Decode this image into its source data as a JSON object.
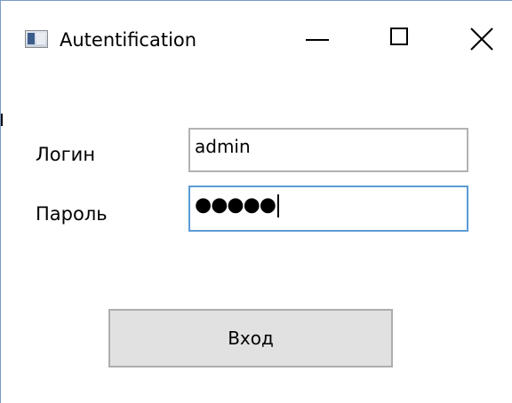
{
  "window": {
    "title": "Autentification",
    "controls": {
      "minimize": "minimize-icon",
      "maximize": "maximize-icon",
      "close": "close-icon"
    }
  },
  "form": {
    "login_label": "Логин",
    "login_value": "admin",
    "password_label": "Пароль",
    "password_mask": "●●●●●",
    "submit_label": "Вход"
  },
  "colors": {
    "button_bg": "#e1e1e1",
    "focus_border": "#5b9bd5",
    "input_border": "#b2b2b2"
  }
}
